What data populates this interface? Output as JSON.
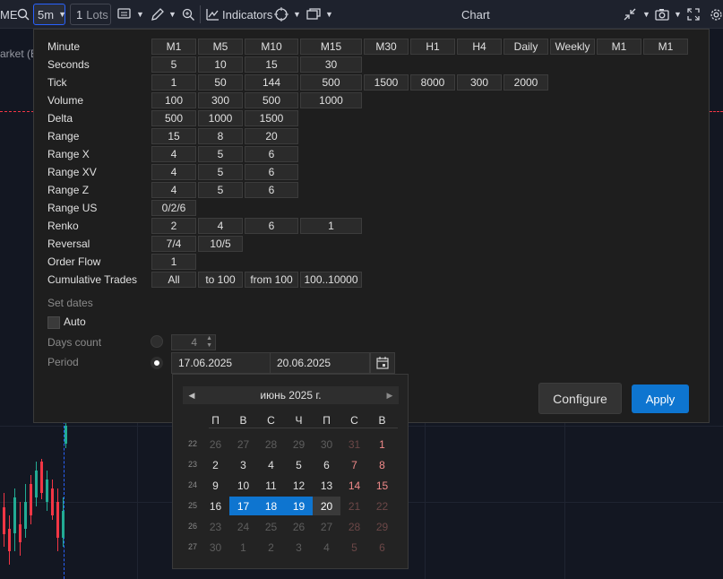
{
  "toolbar": {
    "symbol_fragment": "ME",
    "timeframe": "5m",
    "lots_value": "1",
    "lots_unit": "Lots",
    "indicators_label": "Indicators",
    "chart_title": "Chart"
  },
  "chart": {
    "market_label": "arket (B"
  },
  "panel": {
    "rows": [
      {
        "label": "Minute",
        "cells": [
          "M1",
          "M5",
          "M10",
          "M15",
          "M30",
          "H1",
          "H4",
          "Daily",
          "Weekly",
          "M1",
          "M1"
        ]
      },
      {
        "label": "Seconds",
        "cells": [
          "5",
          "10",
          "15",
          "30"
        ]
      },
      {
        "label": "Tick",
        "cells": [
          "1",
          "50",
          "144",
          "500",
          "1500",
          "8000",
          "300",
          "2000"
        ]
      },
      {
        "label": "Volume",
        "cells": [
          "100",
          "300",
          "500",
          "1000"
        ]
      },
      {
        "label": "Delta",
        "cells": [
          "500",
          "1000",
          "1500"
        ]
      },
      {
        "label": "Range",
        "cells": [
          "15",
          "8",
          "20"
        ]
      },
      {
        "label": "Range X",
        "cells": [
          "4",
          "5",
          "6"
        ]
      },
      {
        "label": "Range XV",
        "cells": [
          "4",
          "5",
          "6"
        ]
      },
      {
        "label": "Range Z",
        "cells": [
          "4",
          "5",
          "6"
        ]
      },
      {
        "label": "Range US",
        "cells": [
          "0/2/6"
        ]
      },
      {
        "label": "Renko",
        "cells": [
          "2",
          "4",
          "6",
          "1"
        ]
      },
      {
        "label": "Reversal",
        "cells": [
          "7/4",
          "10/5"
        ]
      },
      {
        "label": "Order Flow",
        "cells": [
          "1"
        ]
      },
      {
        "label": "Cumulative Trades",
        "cells": [
          "All",
          "to 100",
          "from 100",
          "100..10000"
        ]
      }
    ],
    "set_dates_label": "Set dates",
    "auto_label": "Auto",
    "days_count_label": "Days count",
    "days_count_value": "4",
    "period_label": "Period",
    "period_from": "17.06.2025",
    "period_to": "20.06.2025",
    "configure_label": "Configure",
    "apply_label": "Apply"
  },
  "calendar": {
    "month_label": "июнь 2025 г.",
    "weekdays": [
      "П",
      "В",
      "С",
      "Ч",
      "П",
      "С",
      "В"
    ],
    "weeks": [
      {
        "num": "22",
        "days": [
          "26",
          "27",
          "28",
          "29",
          "30",
          "31",
          "1"
        ]
      },
      {
        "num": "23",
        "days": [
          "2",
          "3",
          "4",
          "5",
          "6",
          "7",
          "8"
        ]
      },
      {
        "num": "24",
        "days": [
          "9",
          "10",
          "11",
          "12",
          "13",
          "14",
          "15"
        ]
      },
      {
        "num": "25",
        "days": [
          "16",
          "17",
          "18",
          "19",
          "20",
          "21",
          "22"
        ]
      },
      {
        "num": "26",
        "days": [
          "23",
          "24",
          "25",
          "26",
          "27",
          "28",
          "29"
        ]
      },
      {
        "num": "27",
        "days": [
          "30",
          "1",
          "2",
          "3",
          "4",
          "5",
          "6"
        ]
      }
    ]
  },
  "colors": {
    "accent": "#0e75d0",
    "weekend": "#f08a8a",
    "panel_bg": "#1e1e1e"
  }
}
